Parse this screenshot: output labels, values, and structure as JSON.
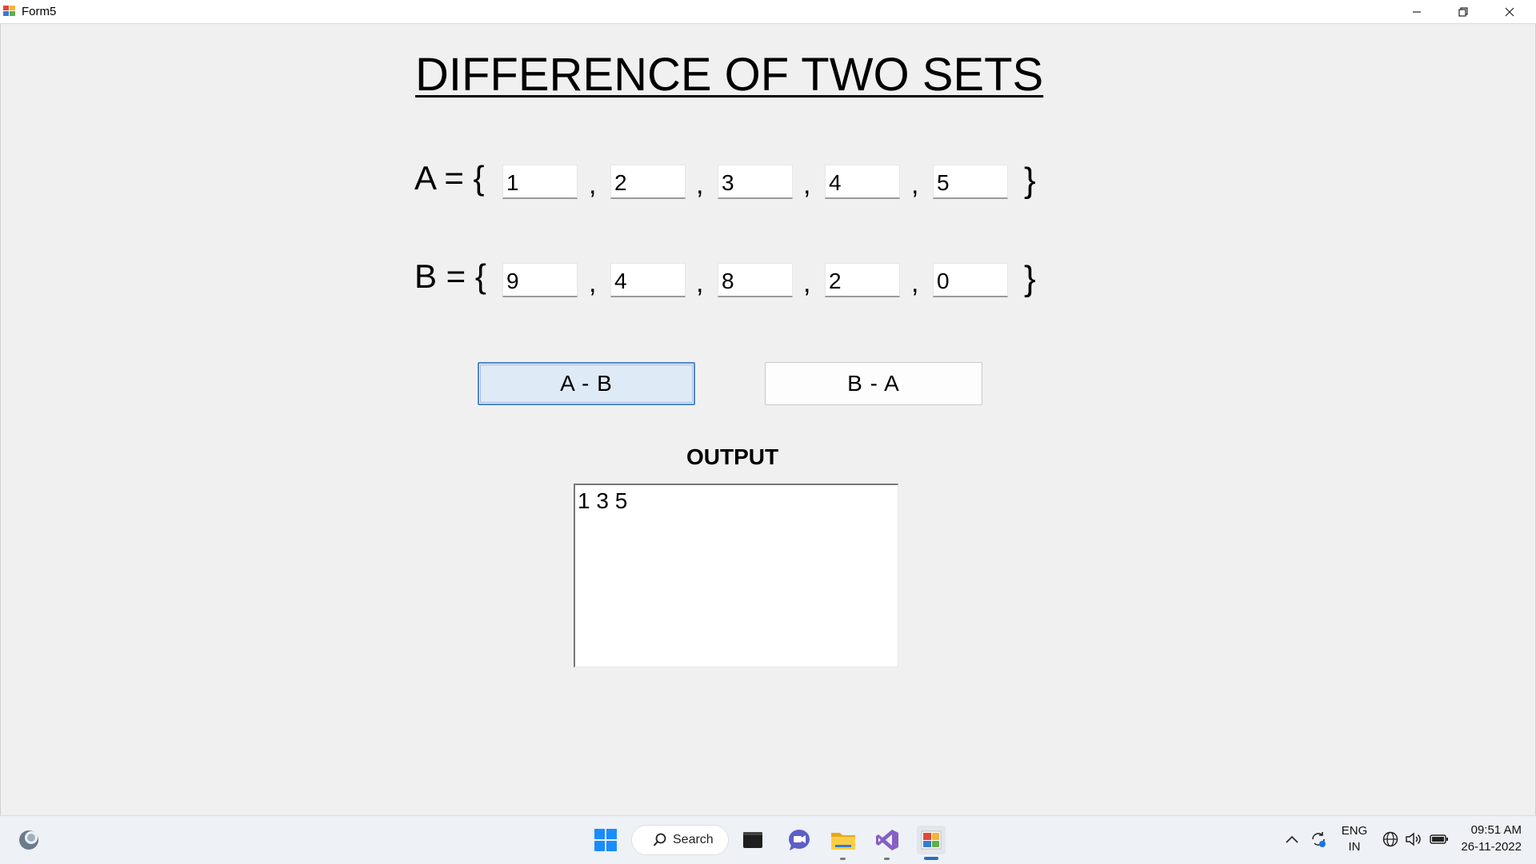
{
  "window": {
    "title": "Form5",
    "controls": [
      "minimize",
      "restore",
      "close"
    ]
  },
  "form": {
    "heading": "DIFFERENCE OF TWO SETS",
    "set_a": {
      "label": "A = {",
      "close": "}",
      "values": [
        "1",
        "2",
        "3",
        "4",
        "5"
      ]
    },
    "set_b": {
      "label": "B = {",
      "close": "}",
      "values": [
        "9",
        "4",
        "8",
        "2",
        "0"
      ]
    },
    "separator": ",",
    "buttons": {
      "a_minus_b": "A - B",
      "b_minus_a": "B - A"
    },
    "output_label": "OUTPUT",
    "output_value": "1 3 5"
  },
  "taskbar": {
    "search_label": "Search",
    "apps": [
      "widgets-icon",
      "start-icon",
      "terminal-icon",
      "teams-chat-icon",
      "file-explorer-icon",
      "visual-studio-icon",
      "form-app-icon"
    ],
    "tray": {
      "lang_primary": "ENG",
      "lang_secondary": "IN",
      "time": "09:51 AM",
      "date": "26-11-2022"
    }
  },
  "colors": {
    "form_bg": "#f0f0f0",
    "focused_button_bg": "#dfeaf7",
    "focused_button_border": "#4f86c6",
    "taskbar_bg": "#eef1f5"
  }
}
